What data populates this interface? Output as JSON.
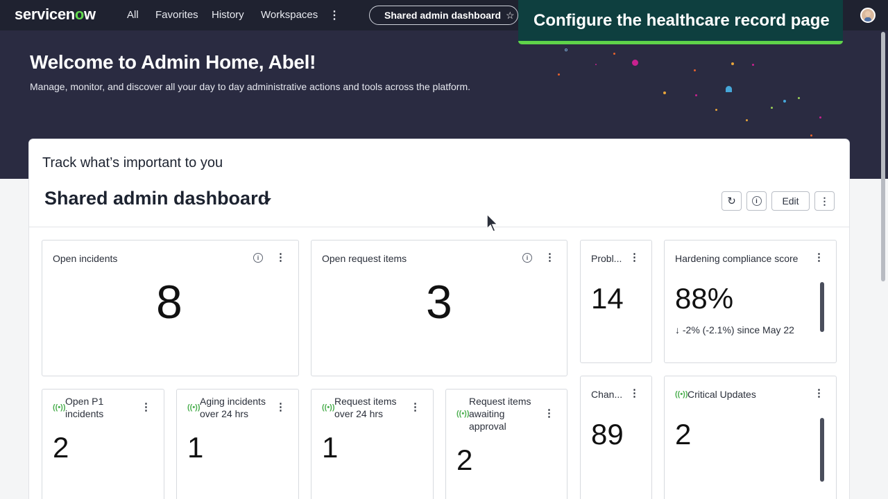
{
  "nav": {
    "logo_prefix": "servicen",
    "logo_o": "o",
    "logo_suffix": "w",
    "links": [
      "All",
      "Favorites",
      "History",
      "Workspaces"
    ],
    "more": "⋮",
    "pill_label": "Shared admin dashboard",
    "pill_star": "☆"
  },
  "banner": {
    "text": "Configure the healthcare record page"
  },
  "hero": {
    "title": "Welcome to Admin Home, Abel!",
    "subtitle": "Manage, monitor, and discover all your day to day administrative actions and tools across the platform."
  },
  "card": {
    "title": "Track what’s important to you",
    "dashboard_title": "Shared admin dashboard",
    "edit_label": "Edit",
    "refresh_icon": "↻",
    "info_icon": "i",
    "kebab": "⋮"
  },
  "tiles": {
    "open_incidents": {
      "label": "Open incidents",
      "value": "8"
    },
    "open_request_items": {
      "label": "Open request items",
      "value": "3"
    },
    "problems": {
      "label": "Probl...",
      "value": "14"
    },
    "hardening": {
      "label": "Hardening compliance score",
      "value": "88%",
      "trend": "↓  -2% (-2.1%) since May 22"
    },
    "open_p1": {
      "label_1": "Open P1",
      "label_2": "incidents",
      "value": "2"
    },
    "aging": {
      "label_1": "Aging incidents",
      "label_2": "over 24 hrs",
      "value": "1"
    },
    "req_24": {
      "label_1": "Request items",
      "label_2": "over 24 hrs",
      "value": "1"
    },
    "req_approval": {
      "label_1": "Request items",
      "label_2": "awaiting",
      "label_3": "approval",
      "value": "2"
    },
    "changes": {
      "label": "Chan...",
      "value": "89"
    },
    "critical": {
      "label": "Critical Updates",
      "value": "2"
    }
  },
  "colors": {
    "nav_bg": "#1f2230",
    "hero_bg": "#2a2b41",
    "accent_green": "#62d84e",
    "banner_bg": "#0e3f3f"
  }
}
